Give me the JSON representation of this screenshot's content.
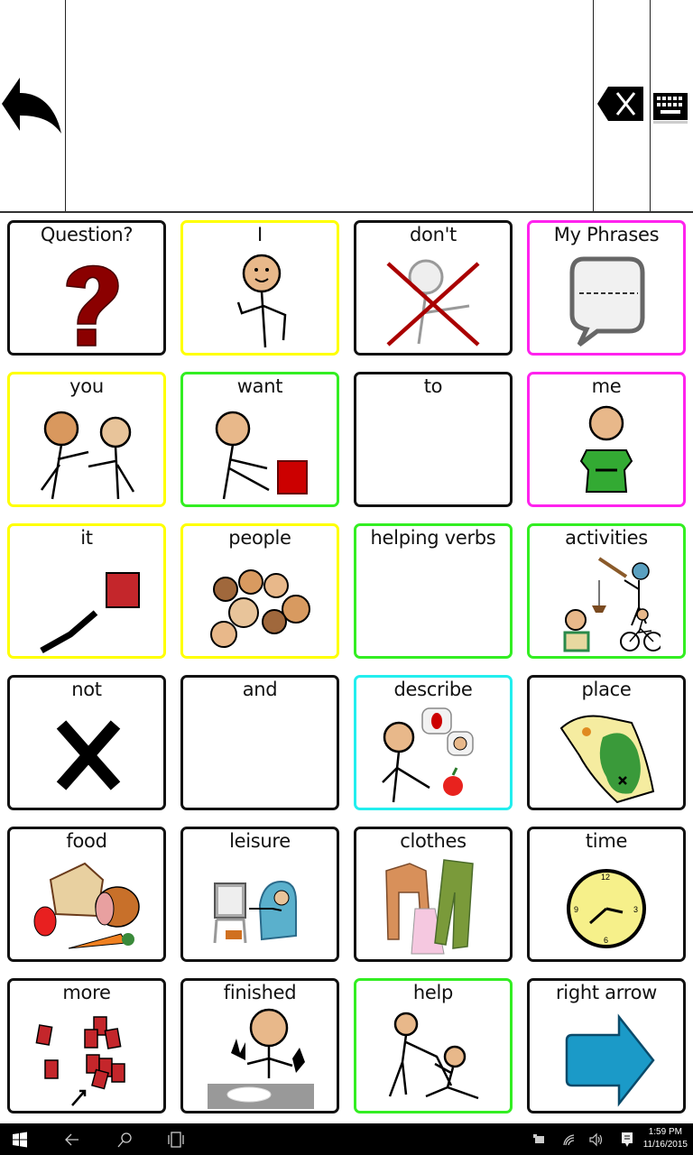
{
  "toolbar": {
    "back_icon": "undo-arrow-icon",
    "clear_icon": "backspace-clear-icon",
    "keyboard_icon": "keyboard-icon",
    "message_text": ""
  },
  "colors": {
    "default_border": "#111111",
    "pronoun_border": "#ffff00",
    "verb_border": "#33ee22",
    "social_border": "#ff22ee",
    "adjective_border": "#22eeee"
  },
  "cells": [
    {
      "label": "Question?",
      "icon": "question-mark-icon",
      "border": "#111111"
    },
    {
      "label": "I",
      "icon": "self-pointing-person-icon",
      "border": "#ffff00"
    },
    {
      "label": "don't",
      "icon": "crossed-out-person-icon",
      "border": "#111111"
    },
    {
      "label": "My Phrases",
      "icon": "speech-bubble-icon",
      "border": "#ff22ee"
    },
    {
      "label": "you",
      "icon": "person-pointing-at-other-icon",
      "border": "#ffff00"
    },
    {
      "label": "want",
      "icon": "person-reaching-box-icon",
      "border": "#33ee22"
    },
    {
      "label": "to",
      "icon": "",
      "border": "#111111"
    },
    {
      "label": "me",
      "icon": "person-pointing-self-icon",
      "border": "#ff22ee"
    },
    {
      "label": "it",
      "icon": "pointing-at-square-icon",
      "border": "#ffff00"
    },
    {
      "label": "people",
      "icon": "group-of-faces-icon",
      "border": "#ffff00"
    },
    {
      "label": "helping verbs",
      "icon": "",
      "border": "#33ee22"
    },
    {
      "label": "activities",
      "icon": "activities-icon",
      "border": "#33ee22"
    },
    {
      "label": "not",
      "icon": "x-mark-icon",
      "border": "#111111"
    },
    {
      "label": "and",
      "icon": "",
      "border": "#111111"
    },
    {
      "label": "describe",
      "icon": "person-describing-icon",
      "border": "#22eeee"
    },
    {
      "label": "place",
      "icon": "treasure-map-icon",
      "border": "#111111"
    },
    {
      "label": "food",
      "icon": "food-icon",
      "border": "#111111"
    },
    {
      "label": "leisure",
      "icon": "tv-armchair-icon",
      "border": "#111111"
    },
    {
      "label": "clothes",
      "icon": "clothes-icon",
      "border": "#111111"
    },
    {
      "label": "time",
      "icon": "clock-icon",
      "border": "#111111"
    },
    {
      "label": "more",
      "icon": "more-squares-icon",
      "border": "#111111"
    },
    {
      "label": "finished",
      "icon": "finished-eating-icon",
      "border": "#111111"
    },
    {
      "label": "help",
      "icon": "person-helping-icon",
      "border": "#33ee22"
    },
    {
      "label": "right arrow",
      "icon": "right-arrow-icon",
      "border": "#111111"
    }
  ],
  "taskbar": {
    "time": "1:59 PM",
    "date": "11/16/2015",
    "icons": [
      "windows-start-icon",
      "back-icon",
      "search-icon",
      "task-view-icon",
      "tablet-mode-icon",
      "wifi-icon",
      "volume-icon",
      "action-center-icon"
    ]
  }
}
